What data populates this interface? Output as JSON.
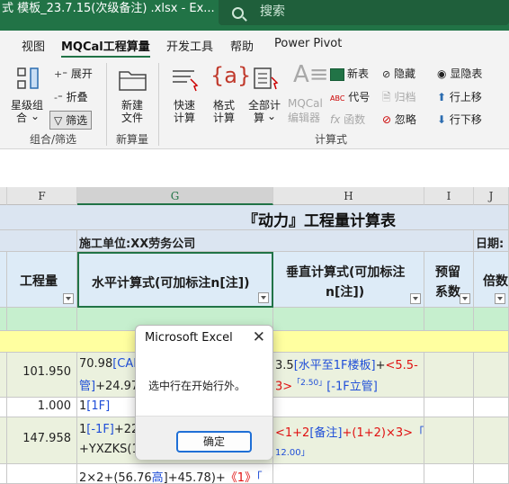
{
  "titlebar": {
    "doc_title": "式 模板_23.7.15(次级备注) .xlsx  -  Ex...",
    "search_placeholder": "搜索"
  },
  "menu_tabs": [
    "视图",
    "MQCal工程算量",
    "开发工具",
    "帮助",
    "Power Pivot"
  ],
  "ribbon": {
    "group_filter": {
      "btn_star": "星级组",
      "btn_star2": "合",
      "btn_expand": "展开",
      "btn_collapse": "折叠",
      "btn_filter": "筛选",
      "label": "组合/筛选"
    },
    "group_new": {
      "btn_new": "新建",
      "btn_new2": "文件",
      "label": "新算量"
    },
    "group_calc": {
      "btn_quick": "快速",
      "btn_quick2": "计算",
      "btn_format": "格式",
      "btn_format2": "计算",
      "btn_all": "全部计",
      "btn_all2": "算",
      "btn_editor": "MQCal",
      "btn_editor2": "编辑器",
      "btn_newtable": "新表",
      "btn_code": "代号",
      "btn_func": "函数",
      "btn_hide": "隐藏",
      "btn_archive": "归档",
      "btn_ignore": "忽略",
      "btn_showtable": "显隐表",
      "btn_up": "行上移",
      "btn_down": "行下移",
      "label": "计算式"
    }
  },
  "columns": [
    "F",
    "G",
    "H",
    "I",
    "J"
  ],
  "sheet": {
    "title": "『动力』工程量计算表",
    "company": "施工单位:XX劳务公司",
    "date_label": "日期:",
    "headers": {
      "qty": "工程量",
      "horizontal": "水平计算式(可加标注n[注])",
      "vertical1": "垂直计算式(可加标注",
      "vertical2": "n[注])",
      "reserve1": "预留",
      "reserve2": "系数",
      "multiple": "倍数"
    },
    "rows": [
      {
        "qty": "101.950",
        "h_line1_a": "70.98",
        "h_line1_b": "[CAD",
        "h_line2_a": "管]",
        "h_line2_b": "+24.97",
        "v_line1_a": "3.5",
        "v_line1_b": "[水平至1F楼板]",
        "v_line1_c": "+",
        "v_line1_d": "<5.5-",
        "v_line2_a": "3>",
        "v_line2_b": "「2.50」",
        "v_line2_c": "[-1F立管]"
      },
      {
        "qty": "1.000",
        "h_a": "1",
        "h_b": "[1F]"
      },
      {
        "qty": "147.958",
        "h_line1_a": "1",
        "h_line1_b": "[-1F]",
        "h_line1_c": "+22",
        "h_line2": "+YXZKS(1,",
        "v_line1_a": "<1+2",
        "v_line1_b": "[备注]",
        "v_line1_c": "+(1+2)×3>",
        "v_line1_d": "「",
        "v_line2": "12.00」"
      },
      {
        "h_a": "2×2+(56.76",
        "h_b": "高",
        "h_c": "]+45.78)+",
        "h_d": "《1》",
        "h_e": "「"
      }
    ]
  },
  "dialog": {
    "title": "Microsoft Excel",
    "message": "选中行在开始行外。",
    "ok": "确定",
    "close": "✕"
  }
}
